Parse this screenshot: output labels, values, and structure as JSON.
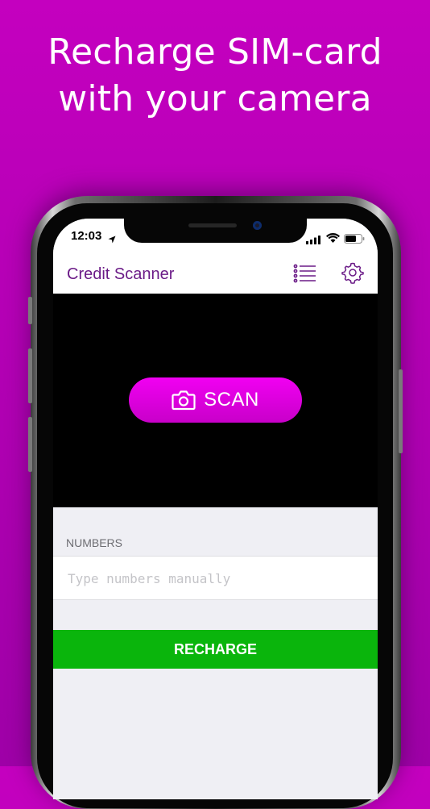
{
  "headline": {
    "line1": "Recharge SIM-card",
    "line2": "with your camera"
  },
  "status_bar": {
    "time": "12:03"
  },
  "nav": {
    "title": "Credit Scanner"
  },
  "scan": {
    "label": "SCAN"
  },
  "numbers": {
    "section_label": "NUMBERS",
    "placeholder": "Type numbers manually",
    "value": ""
  },
  "recharge": {
    "label": "RECHARGE"
  },
  "icons": {
    "location": "location-arrow-icon",
    "signal": "cellular-signal-icon",
    "wifi": "wifi-icon",
    "battery": "battery-icon",
    "list": "list-icon",
    "settings": "gear-icon",
    "camera": "camera-icon"
  },
  "colors": {
    "background": "#c000bd",
    "title": "#6b1b87",
    "scan_button": "#e600e6",
    "recharge_button": "#0ab50c",
    "camera_view": "#000000"
  }
}
